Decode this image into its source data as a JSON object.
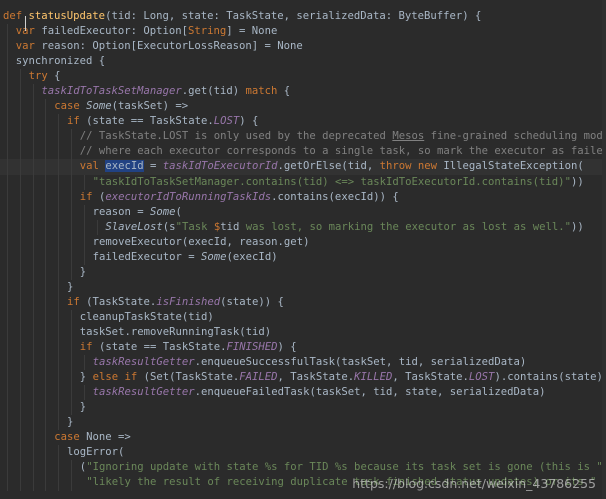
{
  "colors": {
    "background": "#2b2b2b",
    "keyword": "#cc7832",
    "function_name": "#ffc66d",
    "field": "#9876aa",
    "string": "#6a8759",
    "comment": "#808080",
    "default_text": "#a9b7c6"
  },
  "watermark": "https://blog.csdn.net/weixin_43786255",
  "code": [
    {
      "indent": 0,
      "tokens": [
        [
          "kw",
          "def "
        ],
        [
          "fn",
          "statusUpdate"
        ],
        [
          "t",
          "(tid: "
        ],
        [
          "ty",
          "Long"
        ],
        [
          "t",
          ", state: "
        ],
        [
          "ty",
          "TaskState"
        ],
        [
          "t",
          ", serializedData: ByteBuffer) {"
        ]
      ]
    },
    {
      "indent": 1,
      "tokens": [
        [
          "kw",
          "var "
        ],
        [
          "t",
          "failedExecutor: Option["
        ],
        [
          "ptype",
          "String"
        ],
        [
          "t",
          "] = None"
        ]
      ]
    },
    {
      "indent": 1,
      "tokens": [
        [
          "kw",
          "var "
        ],
        [
          "t",
          "reason: Option[ExecutorLossReason] = None"
        ]
      ]
    },
    {
      "indent": 1,
      "tokens": [
        [
          "t",
          "synchronized {"
        ]
      ]
    },
    {
      "indent": 2,
      "tokens": [
        [
          "kw",
          "try "
        ],
        [
          "t",
          "{"
        ]
      ]
    },
    {
      "indent": 3,
      "tokens": [
        [
          "it",
          "taskIdToTaskSetManager"
        ],
        [
          "t",
          ".get(tid) "
        ],
        [
          "kw",
          "match "
        ],
        [
          "t",
          "{"
        ]
      ]
    },
    {
      "indent": 4,
      "tokens": [
        [
          "kw",
          "case "
        ],
        [
          "sobj",
          "Some"
        ],
        [
          "t",
          "(taskSet) =>"
        ]
      ]
    },
    {
      "indent": 5,
      "tokens": [
        [
          "kw",
          "if "
        ],
        [
          "t",
          "(state == TaskState."
        ],
        [
          "it",
          "LOST"
        ],
        [
          "t",
          ") {"
        ]
      ]
    },
    {
      "indent": 6,
      "tokens": [
        [
          "cmt",
          "// TaskState.LOST is only used by the deprecated "
        ],
        [
          "cmtu",
          "Mesos"
        ],
        [
          "cmt",
          " fine-grained scheduling mode,"
        ]
      ]
    },
    {
      "indent": 6,
      "tokens": [
        [
          "cmt",
          "// where each executor corresponds to a single task, so mark the executor as failed."
        ]
      ]
    },
    {
      "indent": 6,
      "current": true,
      "tokens": [
        [
          "kw",
          "val "
        ],
        [
          "sel",
          "execId"
        ],
        [
          "t",
          " = "
        ],
        [
          "it",
          "taskIdToExecutorId"
        ],
        [
          "t",
          ".getOrElse(tid, "
        ],
        [
          "kw",
          "throw new "
        ],
        [
          "t",
          "IllegalStateException("
        ]
      ]
    },
    {
      "indent": 7,
      "tokens": [
        [
          "str",
          "\"taskIdToTaskSetManager.contains(tid) <=> taskIdToExecutorId.contains(tid)\""
        ],
        [
          "t",
          "))"
        ]
      ]
    },
    {
      "indent": 6,
      "tokens": [
        [
          "kw",
          "if "
        ],
        [
          "t",
          "("
        ],
        [
          "it",
          "executorIdToRunningTaskIds"
        ],
        [
          "t",
          ".contains(execId)) {"
        ]
      ]
    },
    {
      "indent": 7,
      "tokens": [
        [
          "t",
          "reason = "
        ],
        [
          "sobj",
          "Some"
        ],
        [
          "t",
          "("
        ]
      ]
    },
    {
      "indent": 8,
      "tokens": [
        [
          "sobj",
          "SlaveLost"
        ],
        [
          "t",
          "(s"
        ],
        [
          "str",
          "\"Task "
        ],
        [
          "interp",
          "$"
        ],
        [
          "t",
          "tid"
        ],
        [
          "str",
          " was lost, so marking the executor as lost as well.\""
        ],
        [
          "t",
          "))"
        ]
      ]
    },
    {
      "indent": 7,
      "tokens": [
        [
          "t",
          "removeExecutor(execId, reason.get)"
        ]
      ]
    },
    {
      "indent": 7,
      "tokens": [
        [
          "t",
          "failedExecutor = "
        ],
        [
          "sobj",
          "Some"
        ],
        [
          "t",
          "(execId)"
        ]
      ]
    },
    {
      "indent": 6,
      "tokens": [
        [
          "t",
          "}"
        ]
      ]
    },
    {
      "indent": 5,
      "tokens": [
        [
          "t",
          "}"
        ]
      ]
    },
    {
      "indent": 5,
      "tokens": [
        [
          "kw",
          "if "
        ],
        [
          "t",
          "(TaskState."
        ],
        [
          "it",
          "isFinished"
        ],
        [
          "t",
          "(state)) {"
        ]
      ]
    },
    {
      "indent": 6,
      "tokens": [
        [
          "t",
          "cleanupTaskState(tid)"
        ]
      ]
    },
    {
      "indent": 6,
      "tokens": [
        [
          "t",
          "taskSet.removeRunningTask(tid)"
        ]
      ]
    },
    {
      "indent": 6,
      "tokens": [
        [
          "kw",
          "if "
        ],
        [
          "t",
          "(state == TaskState."
        ],
        [
          "it",
          "FINISHED"
        ],
        [
          "t",
          ") {"
        ]
      ]
    },
    {
      "indent": 7,
      "tokens": [
        [
          "it",
          "taskResultGetter"
        ],
        [
          "t",
          ".enqueueSuccessfulTask(taskSet, tid, serializedData)"
        ]
      ]
    },
    {
      "indent": 6,
      "tokens": [
        [
          "t",
          "} "
        ],
        [
          "kw",
          "else if "
        ],
        [
          "t",
          "(Set(TaskState."
        ],
        [
          "it",
          "FAILED"
        ],
        [
          "t",
          ", TaskState."
        ],
        [
          "it",
          "KILLED"
        ],
        [
          "t",
          ", TaskState."
        ],
        [
          "it",
          "LOST"
        ],
        [
          "t",
          ").contains(state)) {"
        ]
      ]
    },
    {
      "indent": 7,
      "tokens": [
        [
          "it",
          "taskResultGetter"
        ],
        [
          "t",
          ".enqueueFailedTask(taskSet, tid, state, serializedData)"
        ]
      ]
    },
    {
      "indent": 6,
      "tokens": [
        [
          "t",
          "}"
        ]
      ]
    },
    {
      "indent": 5,
      "tokens": [
        [
          "t",
          "}"
        ]
      ]
    },
    {
      "indent": 4,
      "tokens": [
        [
          "kw",
          "case "
        ],
        [
          "t",
          "None =>"
        ]
      ]
    },
    {
      "indent": 5,
      "tokens": [
        [
          "t",
          "logError("
        ]
      ]
    },
    {
      "indent": 6,
      "tokens": [
        [
          "t",
          "("
        ],
        [
          "str",
          "\"Ignoring update with state %s for TID %s because its task set is gone (this is \""
        ],
        [
          "t",
          " +"
        ]
      ]
    },
    {
      "indent": 6,
      "tokens": [
        [
          "t",
          " "
        ],
        [
          "str",
          "\"likely the result of receiving duplicate task finished status updates) or its \""
        ],
        [
          "t",
          " +"
        ]
      ]
    }
  ]
}
